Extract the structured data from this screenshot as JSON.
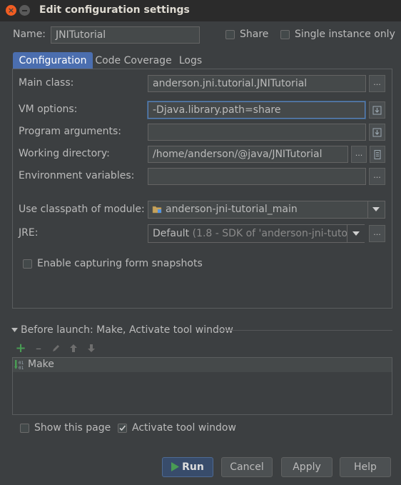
{
  "window": {
    "title": "Edit configuration settings",
    "close_glyph": "×"
  },
  "name_row": {
    "label": "Name:",
    "value": "JNITutorial",
    "share_label": "Share",
    "single_instance_label": "Single instance only"
  },
  "tabs": [
    {
      "label": "Configuration"
    },
    {
      "label": "Code Coverage"
    },
    {
      "label": "Logs"
    }
  ],
  "config": {
    "main_class_label": "Main class:",
    "main_class_value": "anderson.jni.tutorial.JNITutorial",
    "vm_options_label": "VM options:",
    "vm_options_value": "-Djava.library.path=share",
    "program_args_label": "Program arguments:",
    "program_args_value": "",
    "working_dir_label": "Working directory:",
    "working_dir_value": "/home/anderson/@java/JNITutorial",
    "env_vars_label": "Environment variables:",
    "env_vars_value": "",
    "classpath_label": "Use classpath of module:",
    "classpath_value": "anderson-jni-tutorial_main",
    "jre_label": "JRE:",
    "jre_value": "Default",
    "jre_detail": "(1.8 - SDK of 'anderson-jni-tutor",
    "snapshot_label": "Enable capturing form snapshots",
    "browse_label": "..."
  },
  "before_launch": {
    "title": "Before launch: Make, Activate tool window",
    "items": [
      {
        "label": "Make"
      }
    ]
  },
  "bottom": {
    "show_page_label": "Show this page",
    "activate_tool_label": "Activate tool window"
  },
  "buttons": {
    "run": "Run",
    "cancel": "Cancel",
    "apply": "Apply",
    "help": "Help"
  },
  "colors": {
    "accent": "#4b6eaf",
    "add": "#499c54",
    "run": "#499c54"
  }
}
